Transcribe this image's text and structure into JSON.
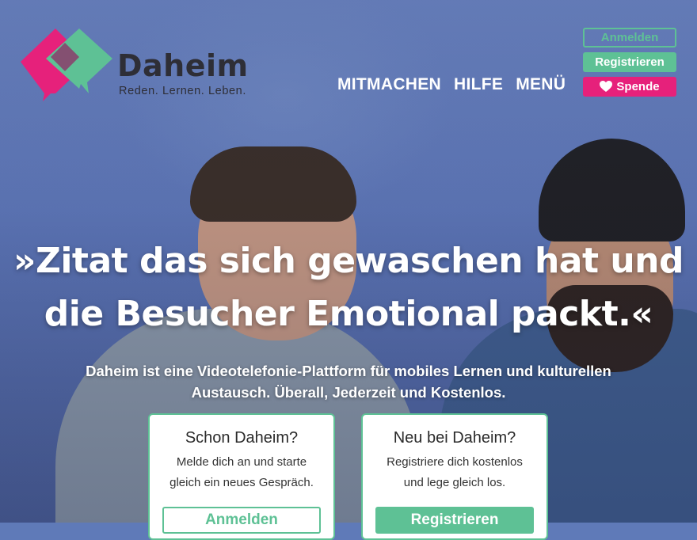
{
  "brand": {
    "name": "Daheim",
    "tagline": "Reden. Lernen. Leben.",
    "colors": {
      "green": "#5ec195",
      "pink": "#e6217b",
      "dark": "#2e2e36"
    }
  },
  "nav": {
    "items": [
      "MITMACHEN",
      "HILFE",
      "MENÜ"
    ]
  },
  "header_buttons": {
    "login": "Anmelden",
    "register": "Registrieren",
    "donate": "Spende",
    "donate_icon": "heart-icon"
  },
  "hero": {
    "quote_line1": "»Zitat das sich gewaschen hat und",
    "quote_line2": "die Besucher Emotional packt.«",
    "description_line1": "Daheim ist eine Videotelefonie-Plattform für mobiles Lernen und kulturellen",
    "description_line2": "Austausch. Überall, Jederzeit und Kostenlos."
  },
  "cards": {
    "login": {
      "title": "Schon Daheim?",
      "text_line1": "Melde dich an und starte",
      "text_line2": "gleich ein neues Gespräch.",
      "button": "Anmelden"
    },
    "signup": {
      "title": "Neu bei Daheim?",
      "text_line1": "Registriere dich kostenlos",
      "text_line2": "und lege gleich los.",
      "button": "Registrieren"
    }
  }
}
